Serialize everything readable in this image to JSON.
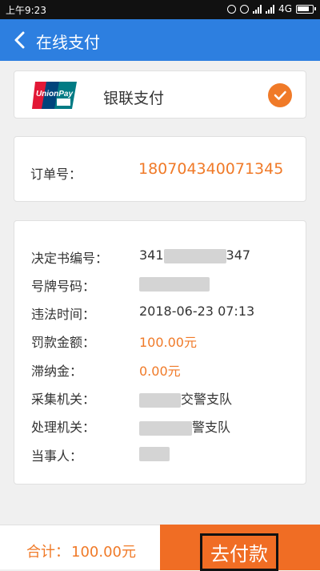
{
  "statusbar": {
    "time": "上午9:23",
    "network": "4G"
  },
  "header": {
    "title": "在线支付",
    "color": "#2d7fe0"
  },
  "payment_method": {
    "label": "银联支付",
    "selected": true
  },
  "order": {
    "label": "订单号：",
    "value": "180704340071345"
  },
  "details": {
    "decision_no": {
      "label": "决定书编号：",
      "prefix": "341",
      "suffix": "347"
    },
    "plate": {
      "label": "号牌号码："
    },
    "violation_time": {
      "label": "违法时间：",
      "value": "2018-06-23 07:13"
    },
    "fine": {
      "label": "罚款金额：",
      "value": "100.00元"
    },
    "late_fee": {
      "label": "滞纳金：",
      "value": "0.00元"
    },
    "collect_agency": {
      "label": "采集机关：",
      "value_suffix": "交警支队"
    },
    "process_agency": {
      "label": "处理机关：",
      "value_suffix": "警支队"
    },
    "party": {
      "label": "当事人："
    }
  },
  "footer": {
    "total_label": "合计：",
    "total_value": "100.00元",
    "pay_button": "去付款"
  },
  "colors": {
    "accent": "#f07a28",
    "primary": "#2d7fe0"
  }
}
